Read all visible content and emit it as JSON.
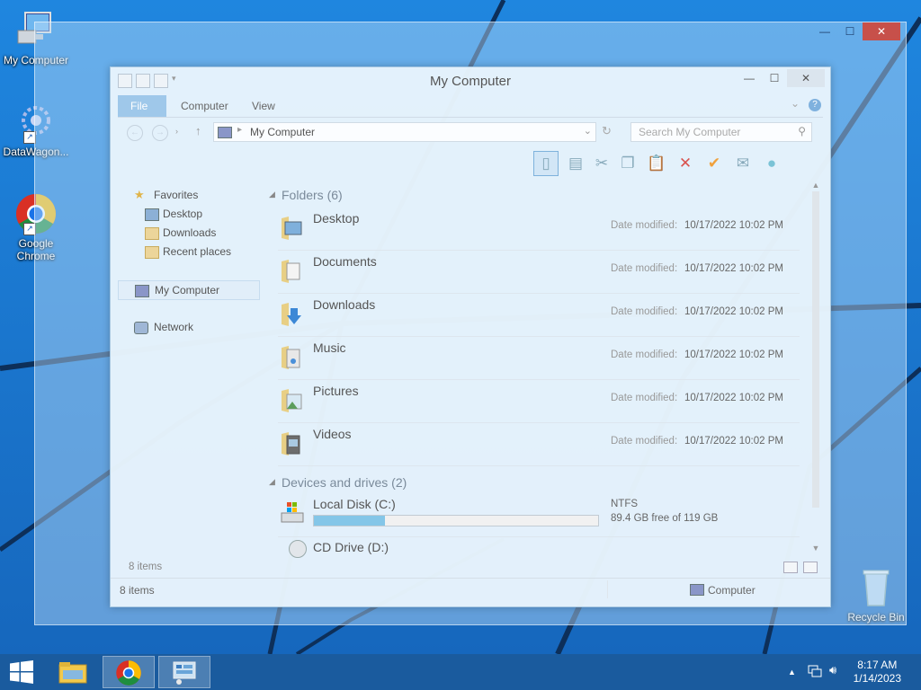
{
  "desktop": {
    "icons": [
      {
        "label": "My Computer",
        "icon": "computer-icon"
      },
      {
        "label": "DataWagon...",
        "icon": "datawagon-icon"
      },
      {
        "label": "Google Chrome",
        "icon": "chrome-icon"
      },
      {
        "label": "Recycle Bin",
        "icon": "recycle-bin-icon"
      }
    ]
  },
  "outer_window": {
    "minimize": "—",
    "maximize": "☐",
    "close": "✕"
  },
  "window": {
    "title": "My Computer",
    "minimize": "—",
    "maximize": "☐",
    "close": "✕",
    "ribbon": {
      "file": "File",
      "computer": "Computer",
      "view": "View",
      "help": "?"
    },
    "address": {
      "path": "My Computer",
      "separator": "▸"
    },
    "search": {
      "placeholder": "Search My Computer"
    },
    "nav_pane": {
      "favorites": "Favorites",
      "desktop": "Desktop",
      "downloads": "Downloads",
      "recent": "Recent places",
      "computer": "My Computer",
      "network": "Network"
    },
    "folders": {
      "header": "Folders (6)",
      "items": [
        {
          "name": "Desktop",
          "date_label": "Date modified:",
          "date": "10/17/2022 10:02 PM"
        },
        {
          "name": "Documents",
          "date_label": "Date modified:",
          "date": "10/17/2022 10:02 PM"
        },
        {
          "name": "Downloads",
          "date_label": "Date modified:",
          "date": "10/17/2022 10:02 PM"
        },
        {
          "name": "Music",
          "date_label": "Date modified:",
          "date": "10/17/2022 10:02 PM"
        },
        {
          "name": "Pictures",
          "date_label": "Date modified:",
          "date": "10/17/2022 10:02 PM"
        },
        {
          "name": "Videos",
          "date_label": "Date modified:",
          "date": "10/17/2022 10:02 PM"
        }
      ]
    },
    "drives": {
      "header": "Devices and drives (2)",
      "local_disk": {
        "name": "Local Disk (C:)",
        "fs": "NTFS",
        "free": "89.4 GB free of 119 GB",
        "used_fraction": 0.249
      },
      "cd_drive": {
        "name": "CD Drive (D:)"
      }
    },
    "pane_status": "8 items",
    "status": {
      "items": "8 items",
      "location": "Computer"
    }
  },
  "taskbar": {
    "clock_time": "8:17 AM",
    "clock_date": "1/14/2023"
  },
  "colors": {
    "wallpaper": "#1e73c8",
    "taskbar": "#1a5b9e",
    "file_tab": "#9fc8ea",
    "drive_fill": "#84c6e8"
  }
}
